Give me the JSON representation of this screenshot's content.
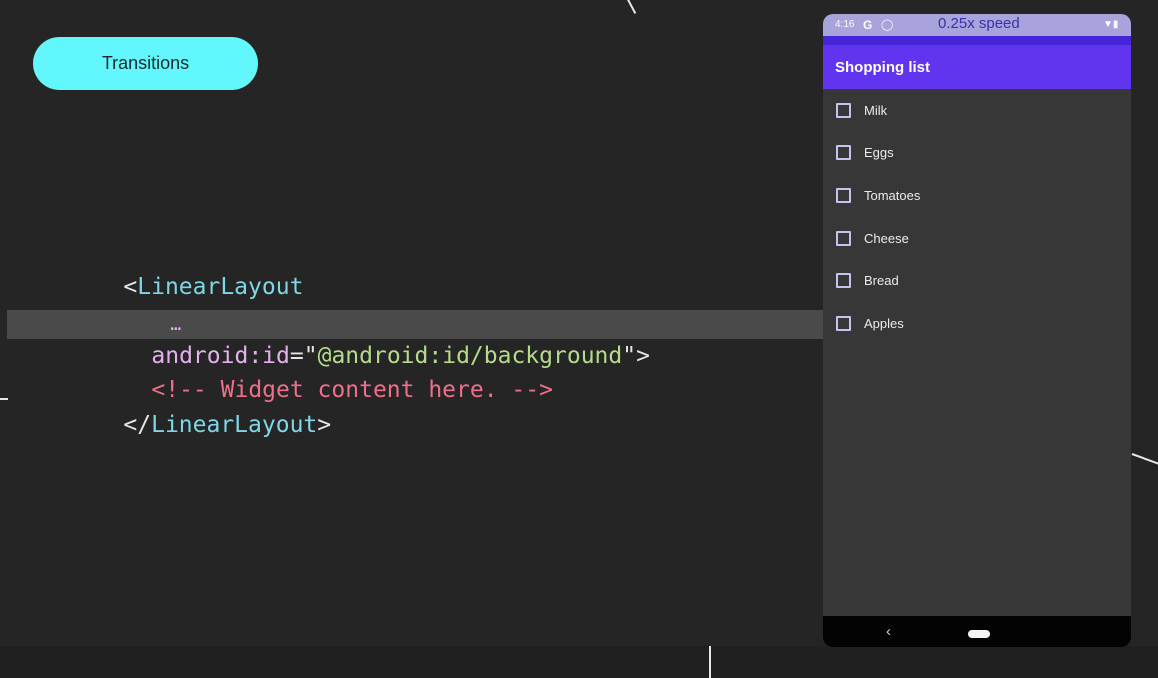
{
  "slide": {
    "section_label": "Transitions"
  },
  "code": {
    "line1": {
      "open_bracket": "<",
      "tag": "LinearLayout"
    },
    "line2": {
      "ellipsis": "…"
    },
    "line3": {
      "attr": "android:id",
      "equals": "=",
      "quote_open": "\"",
      "value": "@android:id/background",
      "quote_close": "\"",
      "close_bracket": ">"
    },
    "line4": {
      "comment": "<!-- Widget content here. -->"
    },
    "line5": {
      "open_bracket": "</",
      "tag": "LinearLayout",
      "close_bracket": ">"
    }
  },
  "phone": {
    "status_bar": {
      "time": "4:16",
      "speed_label": "0.25x speed"
    },
    "app_bar": {
      "title": "Shopping list"
    },
    "items": [
      {
        "label": "Milk",
        "checked": false
      },
      {
        "label": "Eggs",
        "checked": false
      },
      {
        "label": "Tomatoes",
        "checked": false
      },
      {
        "label": "Cheese",
        "checked": false
      },
      {
        "label": "Bread",
        "checked": false
      },
      {
        "label": "Apples",
        "checked": false
      }
    ]
  },
  "colors": {
    "pill": "#61f7fd",
    "app_bar": "#6134ef",
    "status_bar": "#a8a3db",
    "background": "#252526"
  },
  "icons": {
    "google_icon": "google-icon",
    "wifi_icon": "wifi-icon",
    "battery_icon": "battery-icon",
    "back_icon": "back-icon",
    "home_icon": "home-icon"
  }
}
